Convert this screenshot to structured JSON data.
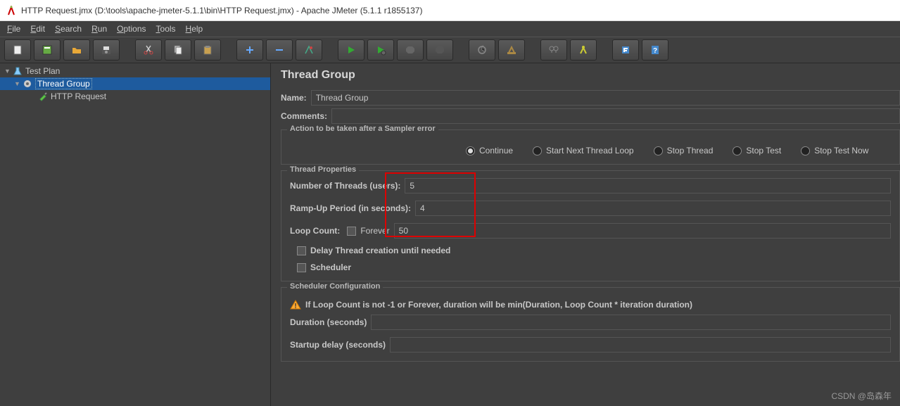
{
  "window": {
    "title": "HTTP Request.jmx (D:\\tools\\apache-jmeter-5.1.1\\bin\\HTTP Request.jmx) - Apache JMeter (5.1.1 r1855137)"
  },
  "menu": {
    "file": "File",
    "edit": "Edit",
    "search": "Search",
    "run": "Run",
    "options": "Options",
    "tools": "Tools",
    "help": "Help"
  },
  "tree": {
    "root": "Test Plan",
    "thread_group": "Thread Group",
    "http_request": "HTTP Request"
  },
  "panel": {
    "title": "Thread Group",
    "name_label": "Name:",
    "name_value": "Thread Group",
    "comments_label": "Comments:",
    "comments_value": "",
    "sampler_error_legend": "Action to be taken after a Sampler error",
    "radio_continue": "Continue",
    "radio_start_next": "Start Next Thread Loop",
    "radio_stop_thread": "Stop Thread",
    "radio_stop_test": "Stop Test",
    "radio_stop_test_now": "Stop Test Now",
    "thread_props_legend": "Thread Properties",
    "num_threads_label": "Number of Threads (users):",
    "num_threads_value": "5",
    "ramp_up_label": "Ramp-Up Period (in seconds):",
    "ramp_up_value": "4",
    "loop_count_label": "Loop Count:",
    "forever_label": "Forever",
    "loop_count_value": "50",
    "delay_thread_label": "Delay Thread creation until needed",
    "scheduler_label": "Scheduler",
    "scheduler_config_legend": "Scheduler Configuration",
    "scheduler_hint": "If Loop Count is not -1 or Forever, duration will be min(Duration, Loop Count * iteration duration)",
    "duration_label": "Duration (seconds)",
    "duration_value": "",
    "startup_delay_label": "Startup delay (seconds)",
    "startup_delay_value": ""
  },
  "watermark": "CSDN @岛森年"
}
